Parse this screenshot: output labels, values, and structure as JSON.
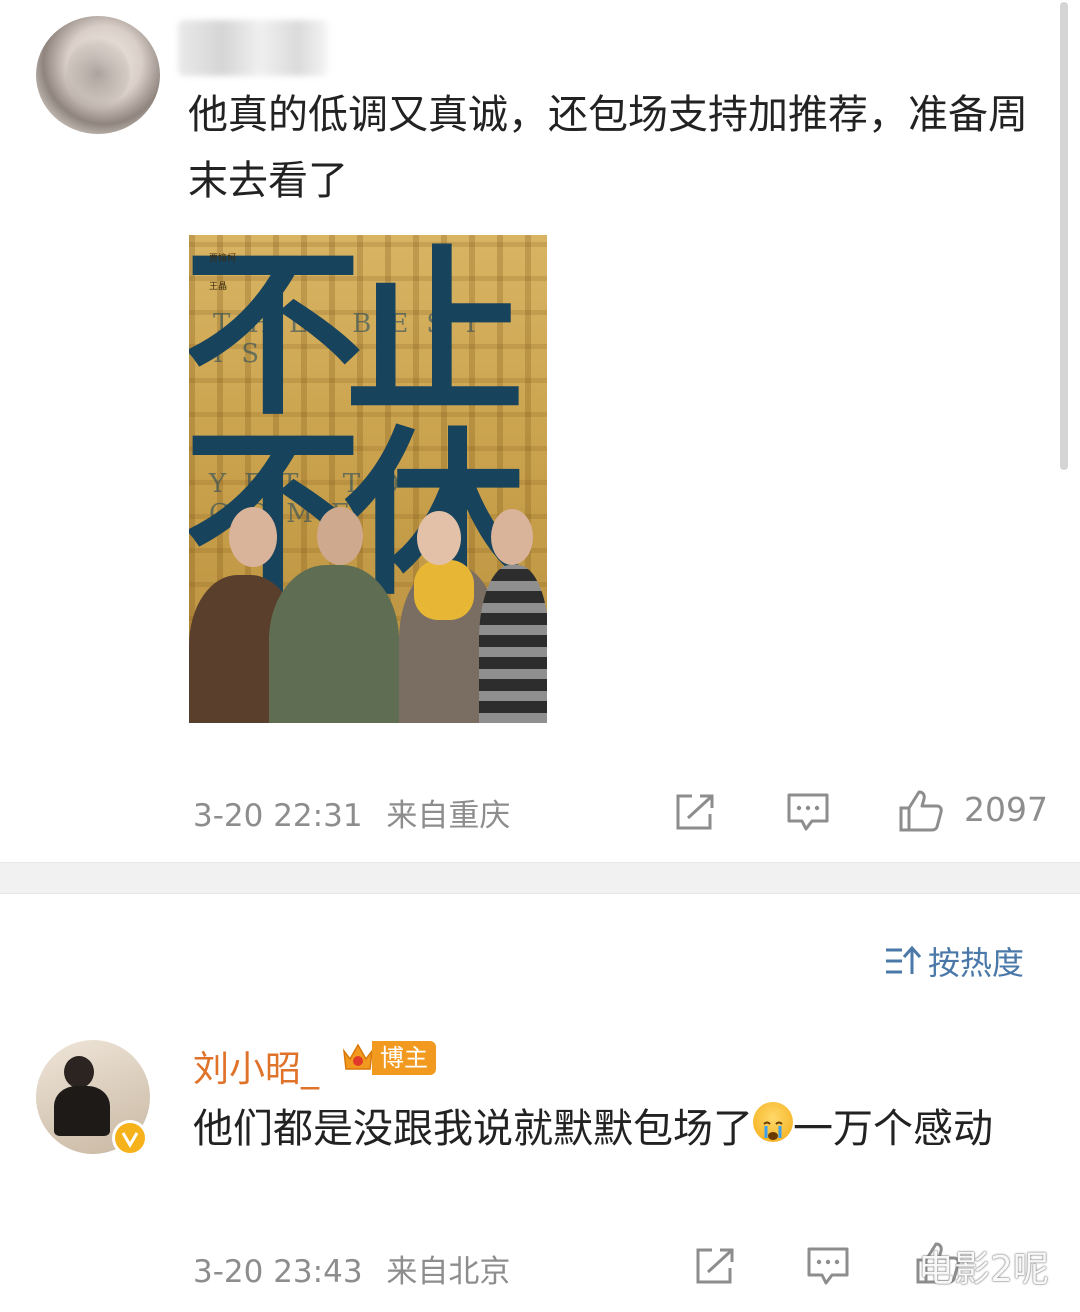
{
  "post": {
    "author_blurred": "",
    "text": "他真的低调又真诚，还包场支持加推荐，准备周末去看了",
    "image": {
      "title_cn_top": "不止",
      "title_cn_bottom": "不休",
      "title_en_top": "THE BEST IS",
      "title_en_bottom": "YET TO COME",
      "credits": [
        "贾樟柯",
        "王晶"
      ]
    },
    "timestamp": "3-20 22:31",
    "source": "来自重庆",
    "like_count": "2097",
    "icons": [
      "share-icon",
      "comment-icon",
      "like-icon"
    ]
  },
  "sort": {
    "label": "按热度",
    "icon": "sort-icon"
  },
  "comment": {
    "author": "刘小昭_",
    "badge": "博主",
    "text_before_emoji": "他们都是没跟我说就默默包场了",
    "text_after_emoji": "一万个感动",
    "emoji": "crying-face",
    "timestamp": "3-20 23:43",
    "source": "来自北京",
    "icons": [
      "share-icon",
      "comment-icon",
      "like-icon"
    ]
  },
  "watermark": "电影2呢",
  "colors": {
    "meta": "#8d8d8d",
    "comment_author": "#e0732a",
    "badge": "#f29a1f",
    "sort": "#4a78a8"
  }
}
